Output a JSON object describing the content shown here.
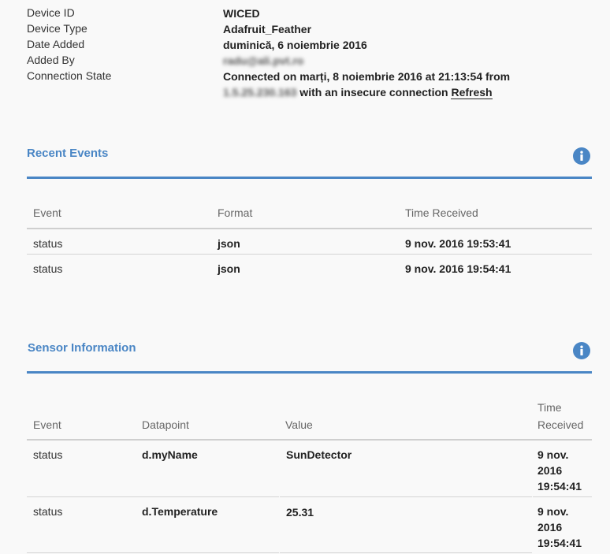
{
  "device": {
    "id_label": "Device ID",
    "id_value": "WICED",
    "type_label": "Device Type",
    "type_value": "Adafruit_Feather",
    "date_label": "Date Added",
    "date_value": "duminică, 6 noiembrie 2016",
    "added_by_label": "Added By",
    "added_by_value": "radu@ali.pvt.ro",
    "conn_label": "Connection State",
    "conn_line1": "Connected on marți, 8 noiembrie 2016 at 21:13:54 from",
    "conn_ip": "1.5.25.230.163",
    "conn_line2_suffix": " with an insecure connection ",
    "refresh_label": "Refresh"
  },
  "recent_events": {
    "title": "Recent Events",
    "columns": [
      "Event",
      "Format",
      "Time Received"
    ],
    "rows": [
      {
        "event": "status",
        "format": "json",
        "time": "9 nov. 2016 19:53:41"
      },
      {
        "event": "status",
        "format": "json",
        "time": "9 nov. 2016 19:54:41"
      }
    ]
  },
  "sensor_info": {
    "title": "Sensor Information",
    "columns": [
      "Event",
      "Datapoint",
      "Value",
      "Time",
      "Received"
    ],
    "rows": [
      {
        "event": "status",
        "datapoint": "d.myName",
        "value": "SunDetector",
        "time1": "9 nov.",
        "time2": "2016",
        "time3": "19:54:41"
      },
      {
        "event": "status",
        "datapoint": "d.Temperature",
        "value": "25.31",
        "time1": "9 nov.",
        "time2": "2016",
        "time3": "19:54:41"
      }
    ]
  },
  "colors": {
    "accent": "#4a86c5"
  },
  "icons": {
    "info": "info-icon"
  }
}
